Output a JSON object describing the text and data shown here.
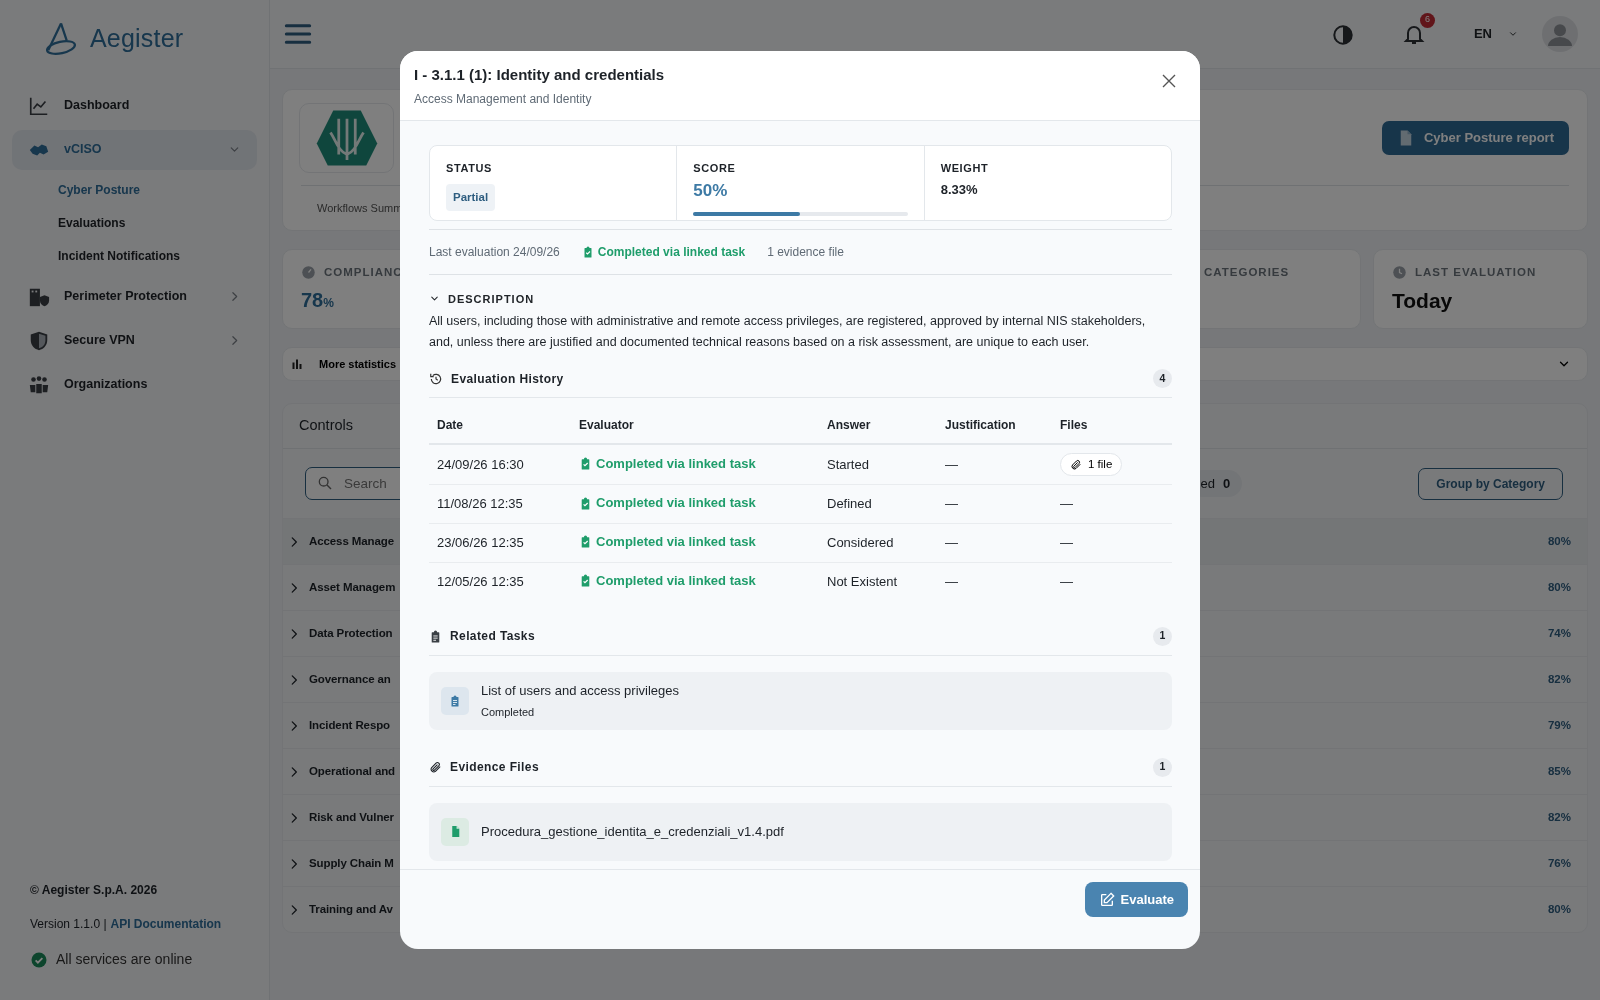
{
  "sidebar": {
    "brand": "Aegister",
    "items": [
      {
        "label": "Dashboard",
        "kind": "link",
        "selected": false
      },
      {
        "label": "vCISO",
        "kind": "group",
        "selected": true,
        "expanded": true,
        "children": [
          {
            "label": "Cyber Posture",
            "selected": true
          },
          {
            "label": "Evaluations",
            "selected": false
          },
          {
            "label": "Incident Notifications",
            "selected": false
          }
        ]
      },
      {
        "label": "Perimeter Protection",
        "kind": "group",
        "selected": false,
        "expanded": false
      },
      {
        "label": "Secure VPN",
        "kind": "group",
        "selected": false,
        "expanded": false
      },
      {
        "label": "Organizations",
        "kind": "link",
        "selected": false
      }
    ],
    "footer": {
      "copyright": "© Aegister S.p.A. 2026",
      "version": "Version 1.1.0 |",
      "docs_link": "API Documentation",
      "status": "All services are online"
    }
  },
  "header": {
    "notifications": "6",
    "language": "EN"
  },
  "overview": {
    "report_button": "Cyber Posture report",
    "tab": "Workflows Summ",
    "stats": [
      {
        "kind": "compliance",
        "label": "COMPLIANC",
        "value": "78",
        "unit": "%"
      },
      {
        "kind": "categories",
        "label": "CATEGORIES"
      },
      {
        "kind": "recency",
        "label": "LAST EVALUATION",
        "value": "Today"
      }
    ],
    "more_statistics": {
      "label": "More statistics",
      "expanded": false
    }
  },
  "controls": {
    "title": "Controls",
    "search": {
      "placeholder": "Search"
    },
    "filter_chip": {
      "label": "ed",
      "count": "0"
    },
    "group_button": "Group by Category",
    "categories": [
      {
        "name": "Access Manage",
        "score": "80%",
        "expanded": false
      },
      {
        "name": "Asset Managem",
        "score": "80%",
        "expanded": false
      },
      {
        "name": "Data Protection",
        "score": "74%",
        "expanded": false
      },
      {
        "name": "Governance an",
        "score": "82%",
        "expanded": false
      },
      {
        "name": "Incident Respo",
        "score": "79%",
        "expanded": false
      },
      {
        "name": "Operational and",
        "score": "85%",
        "expanded": false
      },
      {
        "name": "Risk and Vulner",
        "score": "82%",
        "expanded": false
      },
      {
        "name": "Supply Chain M",
        "score": "76%",
        "expanded": false
      },
      {
        "name": "Training and Av",
        "score": "80%",
        "expanded": false
      }
    ]
  },
  "modal": {
    "title": "I - 3.1.1 (1): Identity and credentials",
    "subtitle": "Access Management and Identity",
    "summary": [
      {
        "kind": "badge",
        "label": "STATUS",
        "value": "Partial"
      },
      {
        "kind": "progress",
        "label": "SCORE",
        "value": "50%",
        "level": 0.5
      },
      {
        "kind": "plain",
        "label": "WEIGHT",
        "value": "8.33%"
      }
    ],
    "meta": {
      "last_evaluation": "Last evaluation 24/09/26",
      "completion": "Completed via linked task",
      "evidence": "1 evidence file"
    },
    "description": {
      "heading": "DESCRIPTION",
      "expanded": true,
      "text": "All users, including those with administrative and remote access privileges, are registered, approved by internal NIS stakeholders, and, unless there are justified and documented technical reasons based on a risk assessment, are unique to each user."
    },
    "history": {
      "heading": "Evaluation History",
      "count": "4",
      "columns": [
        "Date",
        "Evaluator",
        "Answer",
        "Justification",
        "Files"
      ],
      "rows": [
        {
          "date": "24/09/26 16:30",
          "evaluator": "Completed via linked task",
          "answer": "Started",
          "justification": "—",
          "files": "1 file",
          "has_attachment": true
        },
        {
          "date": "11/08/26 12:35",
          "evaluator": "Completed via linked task",
          "answer": "Defined",
          "justification": "—",
          "files": "—",
          "has_attachment": false
        },
        {
          "date": "23/06/26 12:35",
          "evaluator": "Completed via linked task",
          "answer": "Considered",
          "justification": "—",
          "files": "—",
          "has_attachment": false
        },
        {
          "date": "12/05/26 12:35",
          "evaluator": "Completed via linked task",
          "answer": "Not Existent",
          "justification": "—",
          "files": "—",
          "has_attachment": false
        }
      ]
    },
    "tasks": {
      "heading": "Related Tasks",
      "count": "1",
      "items": [
        {
          "title": "List of users and access privileges",
          "status": "Completed"
        }
      ]
    },
    "evidence": {
      "heading": "Evidence Files",
      "count": "1",
      "items": [
        {
          "name": "Procedura_gestione_identita_e_credenziali_v1.4.pdf"
        }
      ]
    },
    "action_button": "Evaluate"
  }
}
